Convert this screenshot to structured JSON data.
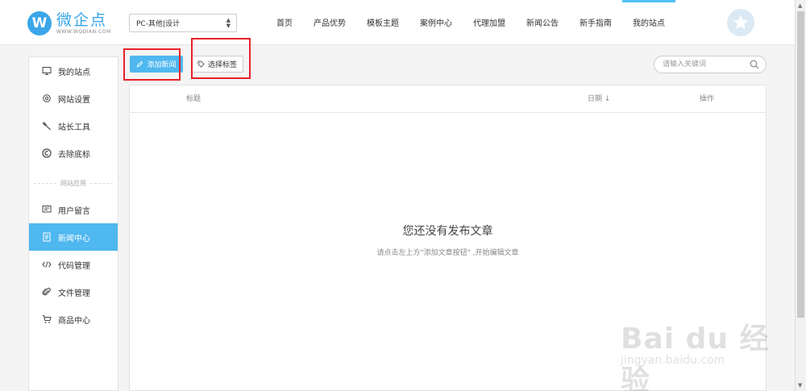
{
  "header": {
    "logo_mark": "W",
    "logo_name": "微企点",
    "logo_sub": "WWW.WQDIAN.COM",
    "site_select_value": "PC-其他|设计",
    "nav": [
      {
        "label": "首页"
      },
      {
        "label": "产品优势"
      },
      {
        "label": "模板主题"
      },
      {
        "label": "案例中心"
      },
      {
        "label": "代理加盟"
      },
      {
        "label": "新闻公告"
      },
      {
        "label": "新手指南"
      },
      {
        "label": "我的站点",
        "active": true
      }
    ],
    "avatar_icon": "star-avatar-icon"
  },
  "sidebar": {
    "items": [
      {
        "label": "我的站点",
        "icon": "monitor-icon"
      },
      {
        "label": "网站设置",
        "icon": "gear-icon"
      },
      {
        "label": "站长工具",
        "icon": "wrench-icon"
      },
      {
        "label": "去除底标",
        "icon": "copyright-icon"
      }
    ],
    "section_label": "网站应用",
    "app_items": [
      {
        "label": "用户留言",
        "icon": "message-icon"
      },
      {
        "label": "新闻中心",
        "icon": "document-icon",
        "active": true
      },
      {
        "label": "代码管理",
        "icon": "code-icon"
      },
      {
        "label": "文件管理",
        "icon": "paperclip-icon"
      },
      {
        "label": "商品中心",
        "icon": "cart-icon"
      }
    ]
  },
  "toolbar": {
    "add_label": "添加新闻",
    "tag_label": "选择标签"
  },
  "search": {
    "placeholder": "请输入关键词",
    "value": ""
  },
  "table": {
    "col_title": "标题",
    "col_date": "日期 ↓",
    "col_action": "操作"
  },
  "empty": {
    "title": "您还没有发布文章",
    "subtitle": "请点击左上方\"添加文章按钮\" ,开始编辑文章"
  },
  "watermark": {
    "main": "Bai du 经验",
    "url": "jingyan.baidu.com"
  },
  "colors": {
    "accent": "#4fb8ef",
    "highlight": "#e8212a",
    "logo": "#3aa6e8"
  }
}
